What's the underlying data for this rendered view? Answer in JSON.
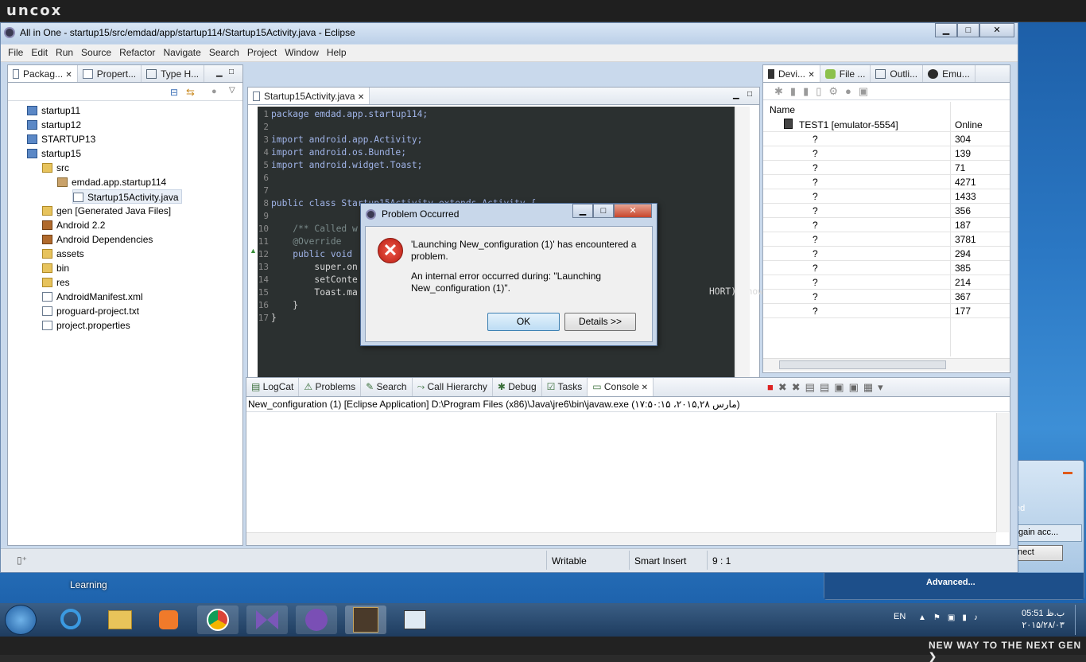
{
  "brand": "uncox",
  "footer_tagline": "NEW WAY TO THE NEXT GEN ❯",
  "window": {
    "title": "All in One - startup15/src/emdad/app/startup114/Startup15Activity.java - Eclipse"
  },
  "menu": [
    "File",
    "Edit",
    "Run",
    "Source",
    "Refactor",
    "Navigate",
    "Search",
    "Project",
    "Window",
    "Help"
  ],
  "left_tabs": [
    "Packag...",
    "Propert...",
    "Type H..."
  ],
  "tree": [
    {
      "label": "startup11",
      "icon": "project-icon",
      "indent": 0
    },
    {
      "label": "startup12",
      "icon": "project-icon",
      "indent": 0
    },
    {
      "label": "STARTUP13",
      "icon": "project-icon",
      "indent": 0
    },
    {
      "label": "startup15",
      "icon": "project-open-icon",
      "indent": 0
    },
    {
      "label": "src",
      "icon": "folder-icon",
      "indent": 1
    },
    {
      "label": "emdad.app.startup114",
      "icon": "package-icon",
      "indent": 2
    },
    {
      "label": "Startup15Activity.java",
      "icon": "java-file-icon",
      "indent": 3
    },
    {
      "label": "gen [Generated Java Files]",
      "icon": "folder-icon",
      "indent": 1
    },
    {
      "label": "Android 2.2",
      "icon": "library-icon",
      "indent": 1
    },
    {
      "label": "Android Dependencies",
      "icon": "library-icon",
      "indent": 1
    },
    {
      "label": "assets",
      "icon": "folder-icon",
      "indent": 1
    },
    {
      "label": "bin",
      "icon": "folder-icon",
      "indent": 1
    },
    {
      "label": "res",
      "icon": "folder-icon",
      "indent": 1
    },
    {
      "label": "AndroidManifest.xml",
      "icon": "xml-file-icon",
      "indent": 1
    },
    {
      "label": "proguard-project.txt",
      "icon": "text-file-icon",
      "indent": 1
    },
    {
      "label": "project.properties",
      "icon": "text-file-icon",
      "indent": 1
    }
  ],
  "editor": {
    "tab": "Startup15Activity.java",
    "lines": [
      {
        "n": "1",
        "t": "package emdad.app.startup114;"
      },
      {
        "n": "2",
        "t": ""
      },
      {
        "n": "3",
        "t": "import android.app.Activity;"
      },
      {
        "n": "4",
        "t": "import android.os.Bundle;"
      },
      {
        "n": "5",
        "t": "import android.widget.Toast;"
      },
      {
        "n": "6",
        "t": ""
      },
      {
        "n": "7",
        "t": ""
      },
      {
        "n": "8",
        "t": "public class Startup15Activity extends Activity {"
      },
      {
        "n": "9",
        "t": ""
      },
      {
        "n": "10",
        "t": "    /** Called w"
      },
      {
        "n": "11",
        "t": "    @Override"
      },
      {
        "n": "12",
        "t": "    public void"
      },
      {
        "n": "13",
        "t": "        super.on"
      },
      {
        "n": "14",
        "t": "        setConte"
      },
      {
        "n": "15",
        "t": "        Toast.ma"
      },
      {
        "n": "16",
        "t": "    }"
      },
      {
        "n": "17",
        "t": "}"
      }
    ],
    "line15_tail": "HORT).show();"
  },
  "right_tabs": [
    "Devi...",
    "File ...",
    "Outli...",
    "Emu..."
  ],
  "devices": {
    "header": "Name",
    "device": "TEST1 [emulator-5554]",
    "status": "Online",
    "rows": [
      {
        "name": "?",
        "pid": "304"
      },
      {
        "name": "?",
        "pid": "139"
      },
      {
        "name": "?",
        "pid": "71"
      },
      {
        "name": "?",
        "pid": "4271"
      },
      {
        "name": "?",
        "pid": "1433"
      },
      {
        "name": "?",
        "pid": "356"
      },
      {
        "name": "?",
        "pid": "187"
      },
      {
        "name": "?",
        "pid": "3781"
      },
      {
        "name": "?",
        "pid": "294"
      },
      {
        "name": "?",
        "pid": "385"
      },
      {
        "name": "?",
        "pid": "214"
      },
      {
        "name": "?",
        "pid": "367"
      },
      {
        "name": "?",
        "pid": "177"
      }
    ]
  },
  "bottom_tabs": [
    "LogCat",
    "Problems",
    "Search",
    "Call Hierarchy",
    "Debug",
    "Tasks",
    "Console"
  ],
  "console": {
    "header": "New_configuration (1) [Eclipse Application] D:\\Program Files (x86)\\Java\\jre6\\bin\\javaw.exe (۱۷:۵۰:۱۵ ،۲۰۱۵,۲۸ مارس)"
  },
  "status": {
    "writable": "Writable",
    "insert": "Smart Insert",
    "pos": "9 : 1"
  },
  "dialog": {
    "title": "Problem Occurred",
    "message": "'Launching New_configuration (1)' has encountered a problem.",
    "detail": "An internal error occurred during: \"Launching New_configuration (1)\".",
    "ok": "OK",
    "details": "Details >>"
  },
  "desktop": {
    "label": "Learning",
    "popup_partial1": "ed",
    "popup_partial2": "gain acc...",
    "popup_partial3": "nect",
    "popup_advanced": "Advanced..."
  },
  "tray": {
    "lang": "EN",
    "time": "05:51 ب.ظ",
    "date": "۲۰۱۵/۲۸/۰۳"
  }
}
